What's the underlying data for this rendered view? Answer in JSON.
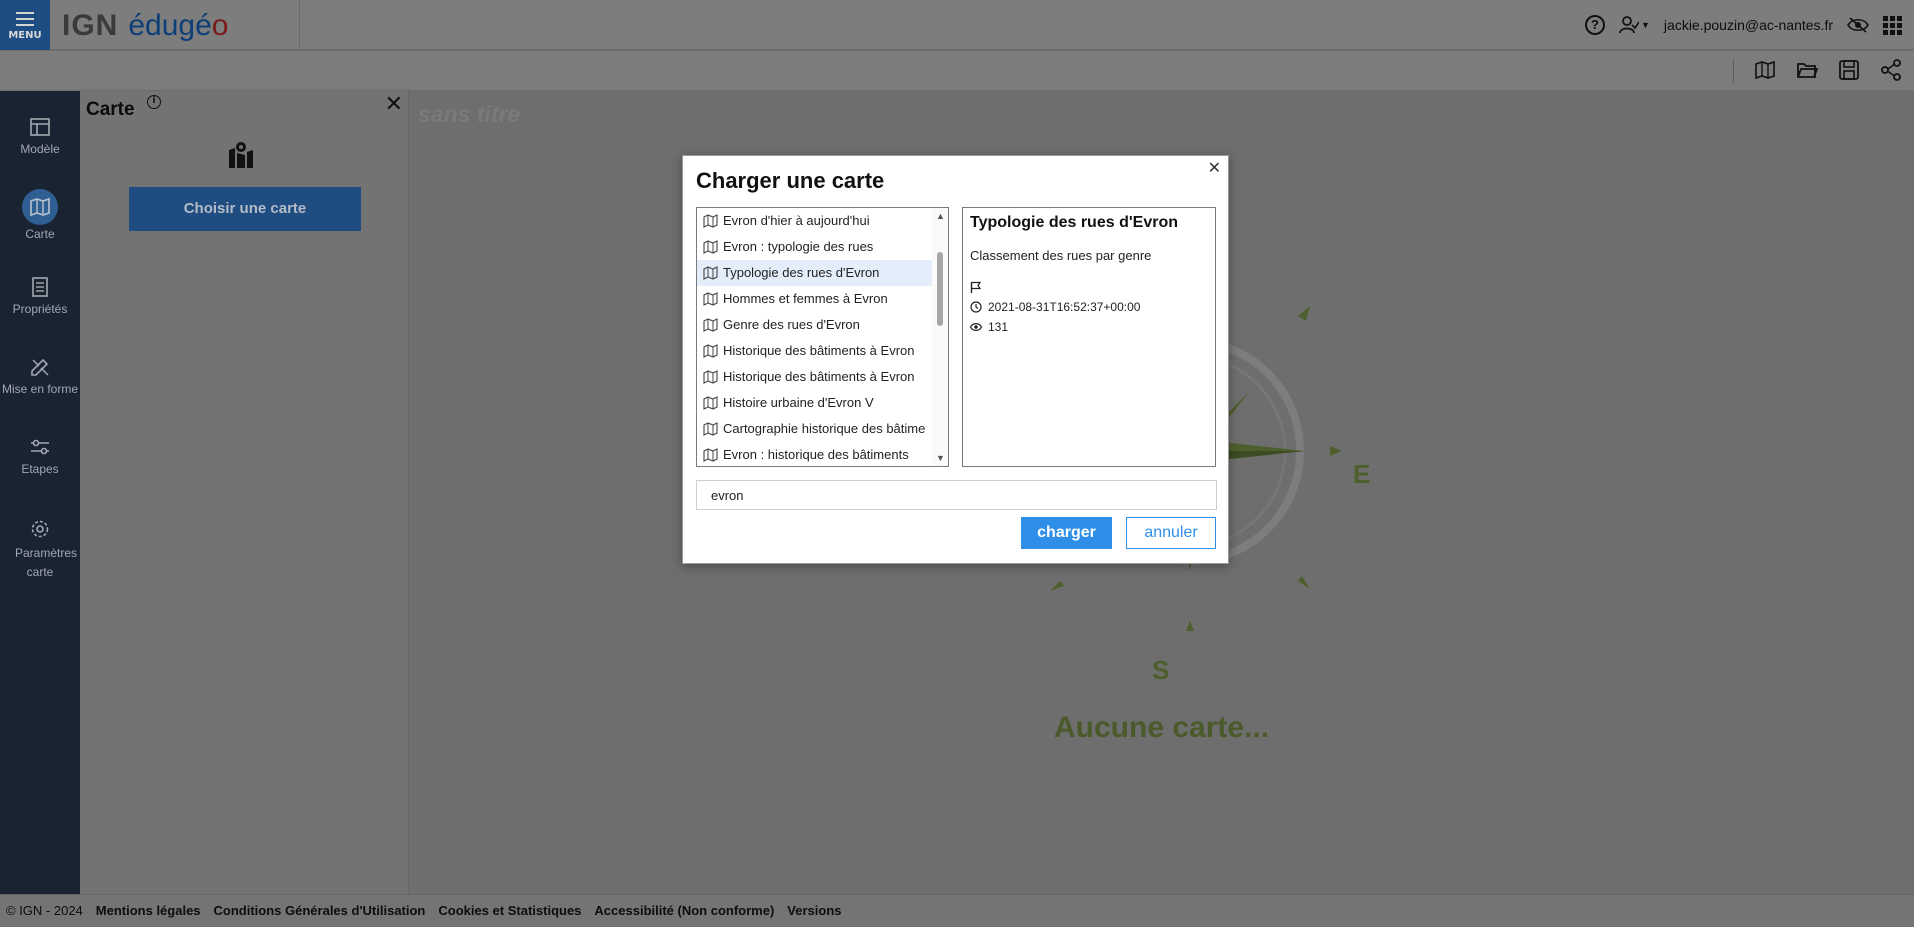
{
  "header": {
    "menu_label": "MENU",
    "brand_ign": "IGN",
    "brand_edu": "édugé",
    "brand_o": "o",
    "user_email": "jackie.pouzin@ac-nantes.fr"
  },
  "sidebar": {
    "items": [
      {
        "label": "Modèle",
        "icon": "layout-icon"
      },
      {
        "label": "Carte",
        "icon": "map-icon",
        "active": true
      },
      {
        "label": "Propriétés",
        "icon": "document-icon"
      },
      {
        "label": "Mise en forme",
        "icon": "style-icon"
      },
      {
        "label": "Etapes",
        "icon": "sliders-icon"
      },
      {
        "label": "Paramètres carte",
        "icon": "gear-icon"
      }
    ]
  },
  "panel": {
    "title": "Carte",
    "choose_button": "Choisir une carte"
  },
  "map": {
    "title": "sans titre",
    "empty_text": "Aucune carte...",
    "compass_east": "E",
    "compass_south": "S"
  },
  "modal": {
    "title": "Charger une carte",
    "items": [
      "Evron d'hier à aujourd'hui",
      "Evron : typologie des rues",
      "Typologie des rues d'Evron",
      "Hommes et femmes à Evron",
      "Genre des rues d'Evron",
      "Historique des bâtiments à Evron",
      "Historique des bâtiments à Evron",
      "Histoire urbaine d'Evron V",
      "Cartographie historique des bâtime",
      "Evron : historique des bâtiments"
    ],
    "selected_index": 2,
    "detail": {
      "title": "Typologie des rues d'Evron",
      "description": "Classement des rues par genre",
      "date": "2021-08-31T16:52:37+00:00",
      "views": "131"
    },
    "search_value": "evron",
    "load_button": "charger",
    "cancel_button": "annuler"
  },
  "footer": {
    "copyright": "© IGN - 2024",
    "links": [
      "Mentions légales",
      "Conditions Générales d'Utilisation",
      "Cookies et Statistiques",
      "Accessibilité (Non conforme)",
      "Versions"
    ]
  }
}
